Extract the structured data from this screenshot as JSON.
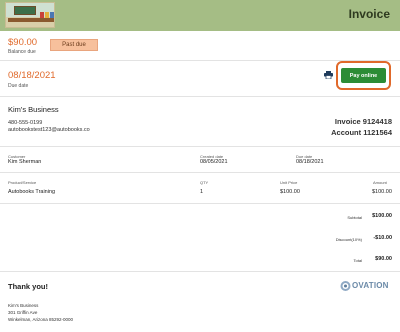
{
  "header": {
    "title": "Invoice",
    "logo_icon": "classroom-logo"
  },
  "summary": {
    "amount": "$90.00",
    "amount_label": "Balance due",
    "badge": "Past due"
  },
  "due": {
    "date": "08/18/2021",
    "label": "Due date"
  },
  "actions": {
    "print_icon": "printer-icon",
    "pay_label": "Pay online"
  },
  "business": {
    "name": "Kim's Business",
    "phone": "480-555-0199",
    "email": "autobookstest123@autobooks.co"
  },
  "invoice": {
    "number": "Invoice 9124418",
    "account": "Account 1121564"
  },
  "details": {
    "customer_label": "Customer",
    "customer": "Kim Sherman",
    "created_label": "Created date",
    "created": "08/05/2021",
    "due_label": "Due date",
    "due": "08/18/2021"
  },
  "table": {
    "headers": [
      "Product/Service",
      "QTY",
      "Unit Price",
      "Amount"
    ],
    "rows": [
      [
        "Autobooks Training",
        "1",
        "$100.00",
        "$100.00"
      ]
    ]
  },
  "totals": {
    "subtotal_label": "Subtotal",
    "subtotal": "$100.00",
    "discount_label": "Discount(10%)",
    "discount": "-$10.00",
    "total_label": "Total",
    "total": "$90.00"
  },
  "footer": {
    "thanks": "Thank you!",
    "brand": "OVATION",
    "address": [
      "Kim's Business",
      "301 Griffin Ave",
      "Winkelman, Arizona 85292-0000"
    ]
  },
  "colors": {
    "header": "#a5bd85",
    "accent": "#e0692a",
    "pay": "#2c8c35",
    "badge": "#f7c09c"
  }
}
